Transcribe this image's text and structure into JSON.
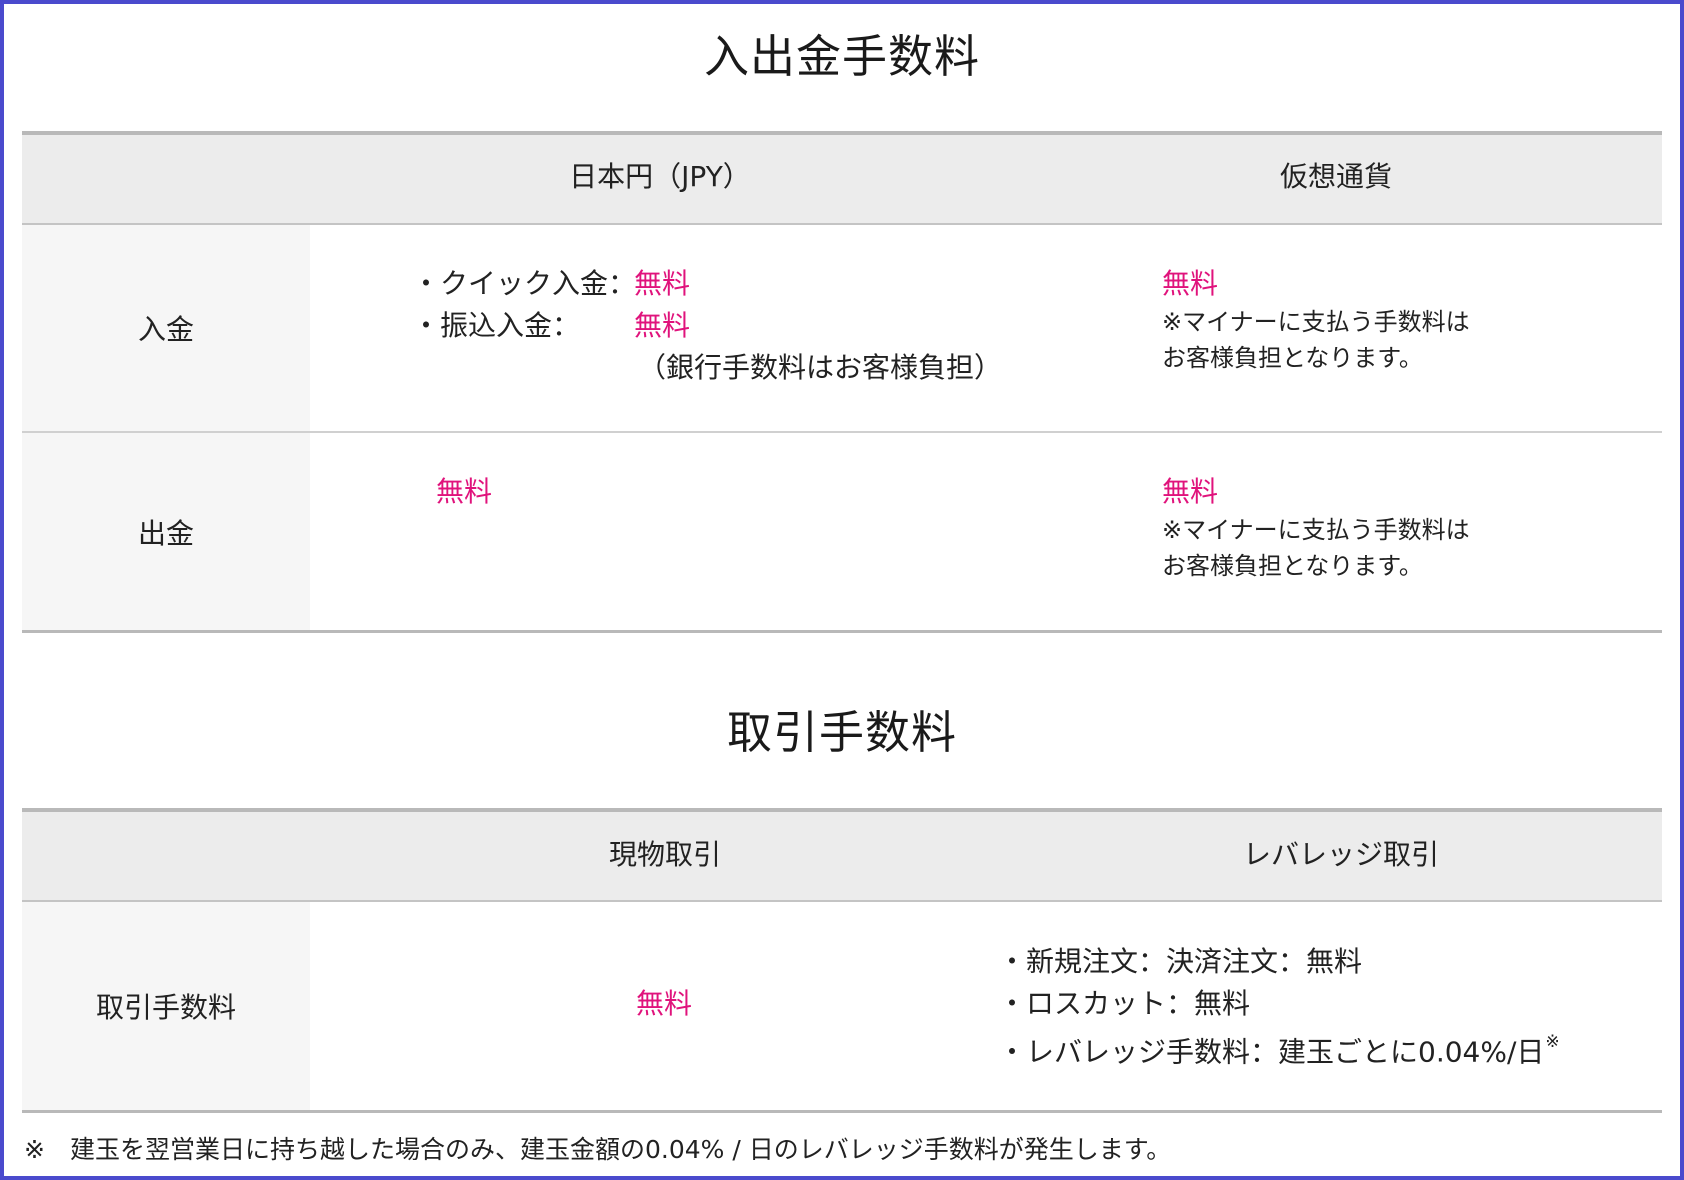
{
  "colors": {
    "accent_pink": "#e0137c",
    "frame_border": "#4a4acd",
    "header_bg": "#ececec",
    "label_bg": "#f6f6f6"
  },
  "deposit_section": {
    "title": "入出金手数料",
    "col_jpy": "日本円（JPY）",
    "col_crypto": "仮想通貨",
    "deposit": {
      "label": "入金",
      "quick_label": "・クイック入金：",
      "quick_value": "無料",
      "transfer_label": "・振込入金：",
      "transfer_value": "無料",
      "transfer_note": "（銀行手数料はお客様負担）",
      "crypto_value": "無料",
      "crypto_note_1": "※マイナーに支払う手数料は",
      "crypto_note_2": "お客様負担となります。"
    },
    "withdrawal": {
      "label": "出金",
      "jpy_value": "無料",
      "crypto_value": "無料",
      "crypto_note_1": "※マイナーに支払う手数料は",
      "crypto_note_2": "お客様負担となります。"
    }
  },
  "trading_section": {
    "title": "取引手数料",
    "col_spot": "現物取引",
    "col_leverage": "レバレッジ取引",
    "row_label": "取引手数料",
    "spot_value": "無料",
    "leverage_line_1": "・新規注文：決済注文：無料",
    "leverage_line_2": "・ロスカット：無料",
    "leverage_line_3": "・レバレッジ手数料：建玉ごとに0.04%/日",
    "leverage_line_3_mark": "※"
  },
  "footnote": {
    "mark": "※",
    "text": "建玉を翌営業日に持ち越した場合のみ、建玉金額の0.04% / 日のレバレッジ手数料が発生します。"
  }
}
